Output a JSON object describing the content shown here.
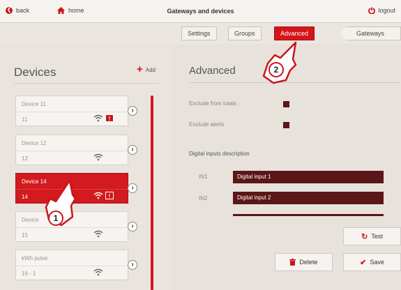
{
  "topbar": {
    "back_label": "back",
    "home_label": "home",
    "title": "Gateways and devices",
    "logout_label": "logout"
  },
  "tabs": [
    {
      "label": "Settings",
      "active": false
    },
    {
      "label": "Groups",
      "active": false
    },
    {
      "label": "Advanced",
      "active": true
    }
  ],
  "gateways_label": "Gateways",
  "devices_panel": {
    "title": "Devices",
    "add_label": "Add",
    "devices": [
      {
        "name": "Device 11",
        "id": "11",
        "alert": true,
        "active": false
      },
      {
        "name": "Device 12",
        "id": "12",
        "alert": false,
        "active": false
      },
      {
        "name": "Device 14",
        "id": "14",
        "alert": true,
        "active": true
      },
      {
        "name": "Device",
        "id": "15",
        "alert": false,
        "active": false
      },
      {
        "name": "kWh pulse",
        "id": "16 - 1",
        "alert": false,
        "active": false
      }
    ],
    "alert_badge": "!"
  },
  "advanced": {
    "title": "Advanced",
    "exclude_totals_label": "Exclude from totals :",
    "exclude_alerts_label": "Exclude alerts",
    "digital_inputs_title": "Digital inputs description",
    "inputs": [
      {
        "label": "IN1",
        "value": "Digital input 1"
      },
      {
        "label": "IN2",
        "value": "Digital input 2"
      }
    ],
    "test_label": "Test",
    "delete_label": "Delete",
    "save_label": "Save"
  },
  "callouts": [
    "1",
    "2"
  ],
  "colors": {
    "accent": "#d5151b",
    "dark_field": "#5b1617",
    "background": "#e7e2dc"
  }
}
